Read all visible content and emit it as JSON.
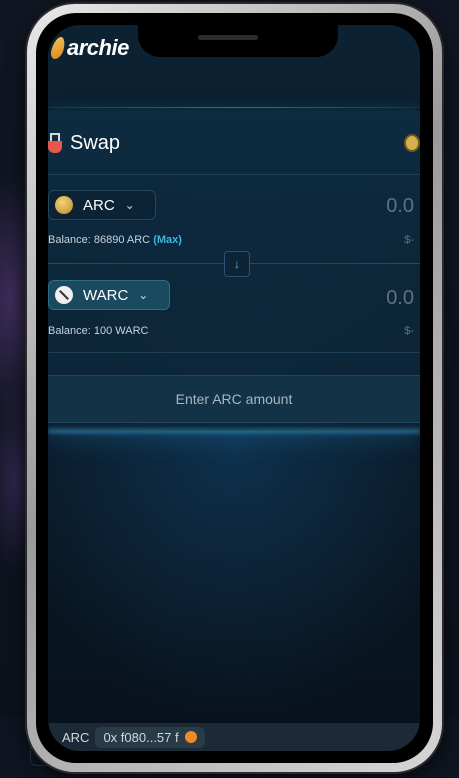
{
  "app": {
    "logo_text": "archie"
  },
  "swap": {
    "title": "Swap",
    "from": {
      "token": "ARC",
      "amount": "0.0",
      "balance_prefix": "Balance: 86890 ARC",
      "max_label": "(Max)",
      "usd": "$-"
    },
    "to": {
      "token": "WARC",
      "amount": "0.0",
      "balance": "Balance: 100 WARC",
      "usd": "$-"
    },
    "action_label": "Enter ARC amount"
  },
  "bottom": {
    "token_label": "ARC",
    "address": "0x f080...57 f"
  },
  "colors": {
    "accent": "#3fb6dc",
    "background": "#0a1a28",
    "logo": "#f6c15a"
  }
}
